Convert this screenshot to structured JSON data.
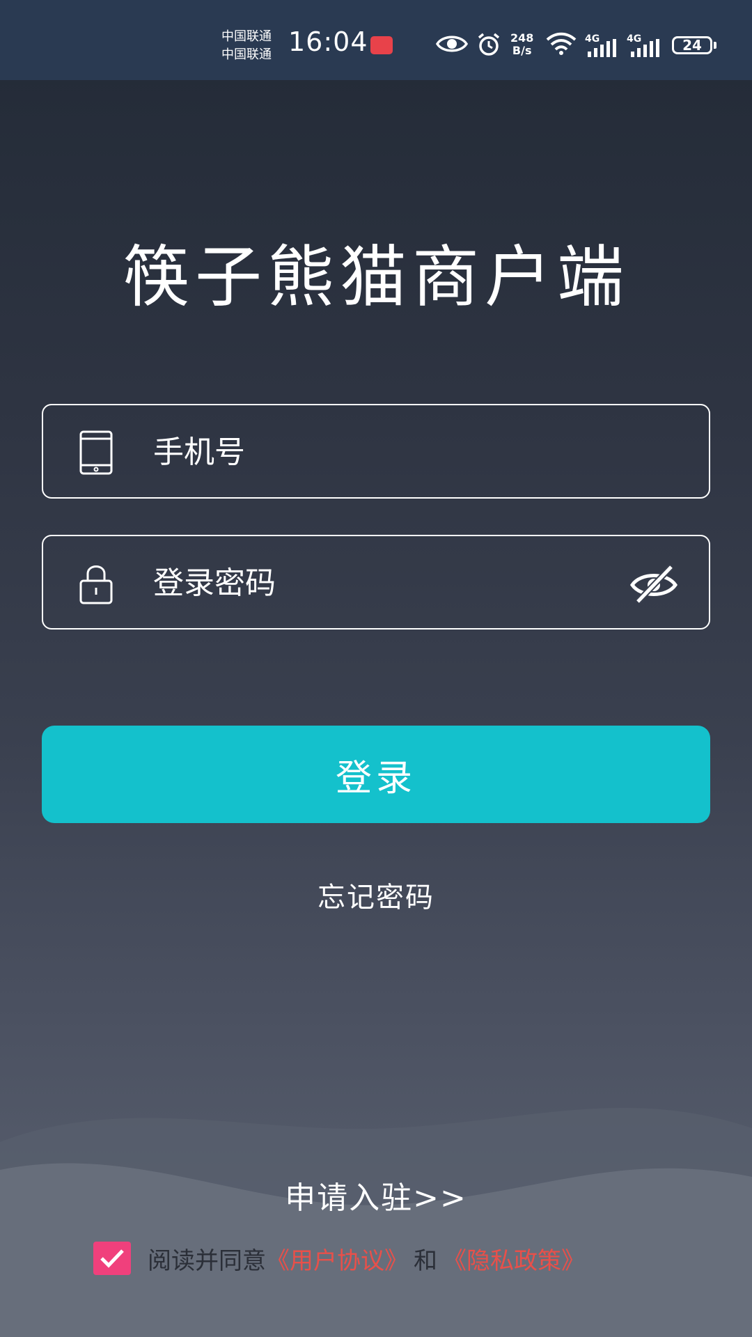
{
  "status_bar": {
    "carrier_1": "中国联通",
    "carrier_2": "中国联通",
    "time": "16:04",
    "speed_value": "248",
    "speed_unit": "B/s",
    "net_1": "4G",
    "net_2": "4G",
    "battery": "24",
    "icons": [
      "huawei-badge-icon",
      "eye-icon",
      "alarm-icon",
      "wifi-icon",
      "signal-icon",
      "signal-icon",
      "battery-icon"
    ]
  },
  "app": {
    "title": "筷子熊猫商户端"
  },
  "form": {
    "phone_placeholder": "手机号",
    "phone_value": "",
    "password_placeholder": "登录密码",
    "password_value": "",
    "password_visibility_icon": "eye-off-icon",
    "login_label": "登录",
    "forgot_label": "忘记密码"
  },
  "footer": {
    "apply_label": "申请入驻>>",
    "agree_checked": true,
    "agree_prefix": "阅读并同意",
    "user_agreement": "《用户协议》",
    "and_text": "和",
    "privacy_policy": "《隐私政策》"
  },
  "colors": {
    "accent": "#14c1cc",
    "checkbox": "#f0407c",
    "link": "#e8504a",
    "status_bar": "#2a3a52"
  }
}
